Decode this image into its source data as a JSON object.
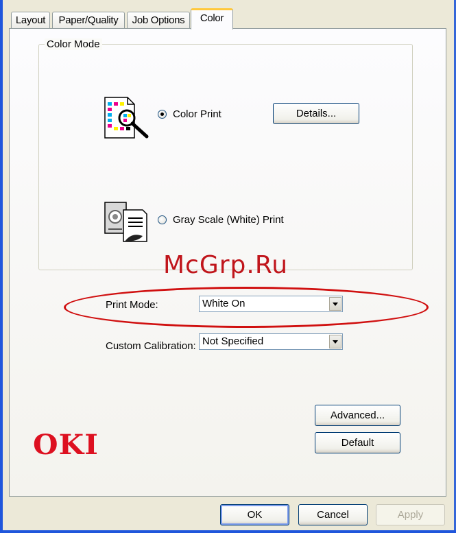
{
  "tabs": [
    "Layout",
    "Paper/Quality",
    "Job Options",
    "Color"
  ],
  "active_tab": "Color",
  "color_mode": {
    "group_label": "Color Mode",
    "color_print_label": "Color Print",
    "gray_scale_label": "Gray Scale (White) Print",
    "selected": "Color Print",
    "details_button": "Details..."
  },
  "print_mode": {
    "label": "Print Mode:",
    "value": "White On"
  },
  "custom_calibration": {
    "label": "Custom Calibration:",
    "value": "Not Specified"
  },
  "buttons": {
    "advanced": "Advanced...",
    "default": "Default",
    "ok": "OK",
    "cancel": "Cancel",
    "apply": "Apply"
  },
  "logo": "OKI",
  "watermark": "McGrp.Ru",
  "colors": {
    "accent_tab": "#FFC83C",
    "annotation_red": "#D01010",
    "oki_red": "#DD1020",
    "frame_blue": "#1F56DC"
  }
}
